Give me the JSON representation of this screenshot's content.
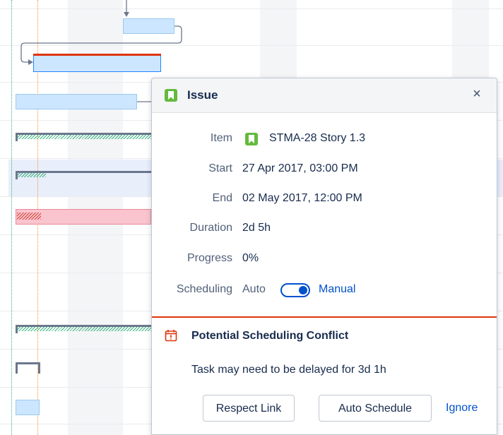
{
  "popup": {
    "title": "Issue",
    "close_label": "×",
    "fields": {
      "item_label": "Item",
      "item_key": "STMA-28 Story 1.3",
      "start_label": "Start",
      "start_value": "27 Apr 2017, 03:00 PM",
      "end_label": "End",
      "end_value": "02 May 2017, 12:00 PM",
      "duration_label": "Duration",
      "duration_value": "2d 5h",
      "progress_label": "Progress",
      "progress_value": "0%",
      "scheduling_label": "Scheduling",
      "scheduling_auto": "Auto",
      "scheduling_manual": "Manual",
      "scheduling_is_manual": true
    },
    "conflict": {
      "title": "Potential Scheduling Conflict",
      "message": "Task may need to be delayed for 3d 1h",
      "respect_link_label": "Respect Link",
      "auto_schedule_label": "Auto Schedule",
      "ignore_label": "Ignore"
    }
  },
  "colors": {
    "accent": "#0052cc",
    "issue_icon": "#63ba3c",
    "conflict": "#de350b",
    "bar_blue": "#cce6ff",
    "bar_pink": "#f9c4cd"
  },
  "icons": {
    "issue_type": "bookmark-icon",
    "conflict": "calendar-alert-icon",
    "close": "close-icon"
  }
}
